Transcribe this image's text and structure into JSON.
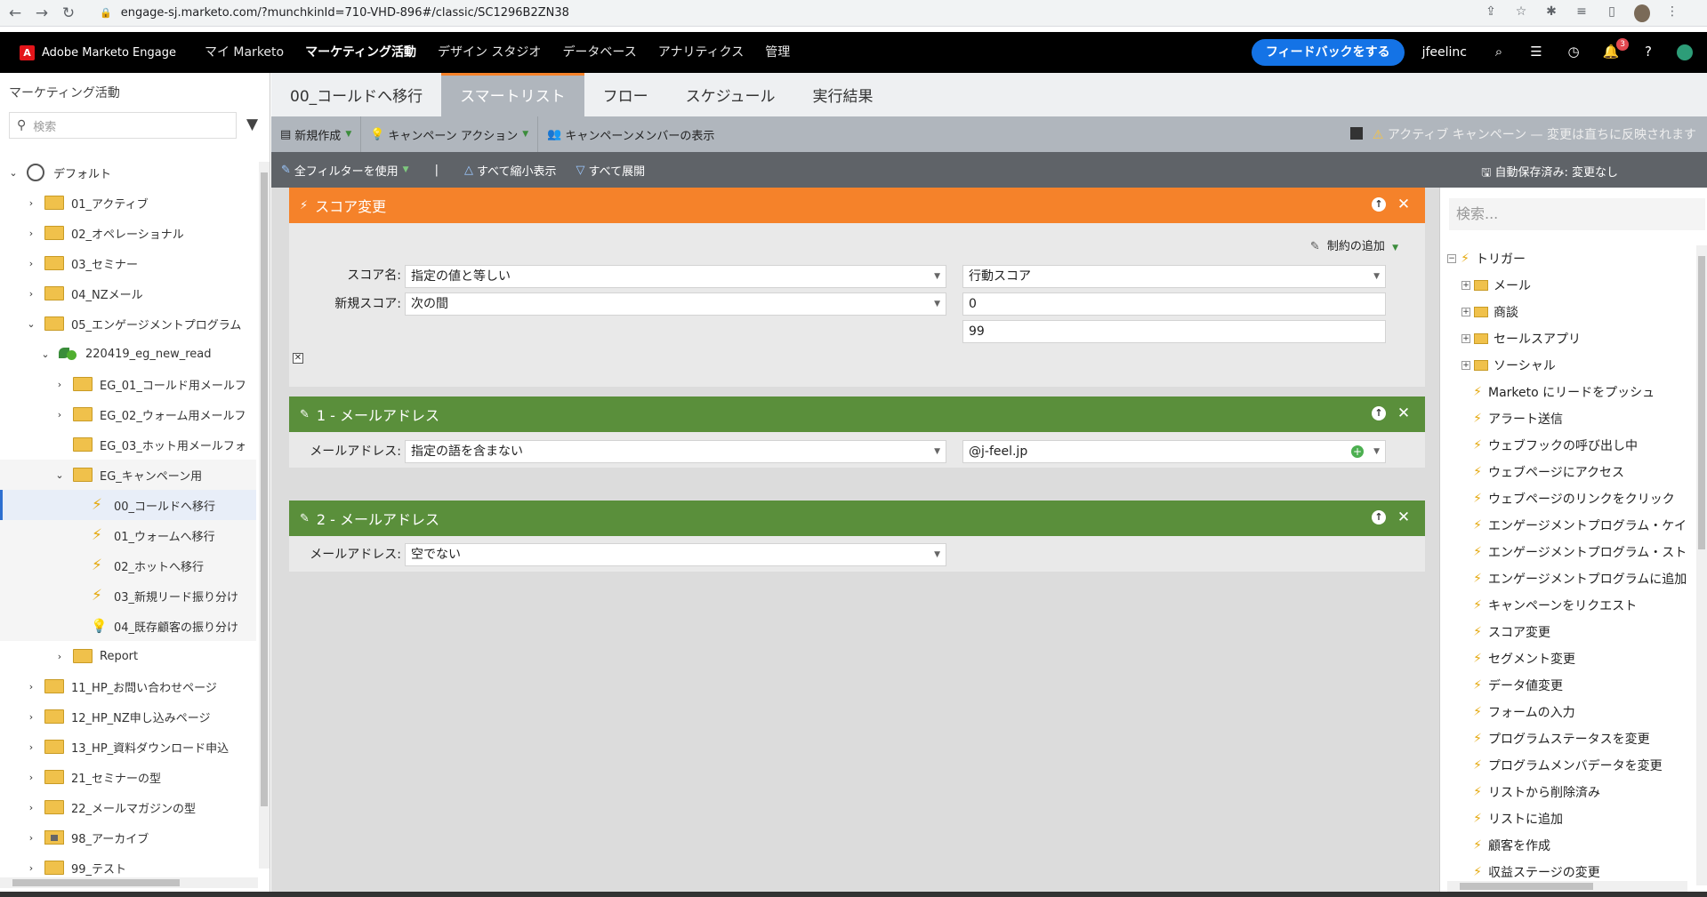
{
  "browser": {
    "url": "engage-sj.marketo.com/?munchkinId=710-VHD-896#/classic/SC1296B2ZN38"
  },
  "topnav": {
    "logo": "Adobe Marketo Engage",
    "menu": [
      "マイ Marketo",
      "マーケティング活動",
      "デザイン スタジオ",
      "データベース",
      "アナリティクス",
      "管理"
    ],
    "feedback": "フィードバックをする",
    "user": "jfeelinc",
    "notifications": "3"
  },
  "left": {
    "title": "マーケティング活動",
    "search_placeholder": "検索",
    "tree": [
      {
        "label": "デフォルト",
        "type": "globe",
        "chev": "⌄",
        "indent": 8
      },
      {
        "label": "01_アクティブ",
        "type": "folder",
        "chev": "›",
        "indent": 28
      },
      {
        "label": "02_オペレーショナル",
        "type": "folder",
        "chev": "›",
        "indent": 28
      },
      {
        "label": "03_セミナー",
        "type": "folder",
        "chev": "›",
        "indent": 28
      },
      {
        "label": "04_NZメール",
        "type": "folder",
        "chev": "›",
        "indent": 28
      },
      {
        "label": "05_エンゲージメントプログラム",
        "type": "folder",
        "chev": "⌄",
        "indent": 28
      },
      {
        "label": "220419_eg_new_read",
        "type": "program",
        "chev": "⌄",
        "indent": 44
      },
      {
        "label": "EG_01_コールド用メールフ",
        "type": "folder",
        "chev": "›",
        "indent": 60
      },
      {
        "label": "EG_02_ウォーム用メールフ",
        "type": "folder",
        "chev": "›",
        "indent": 60
      },
      {
        "label": "EG_03_ホット用メールフォ",
        "type": "folder",
        "chev": "",
        "indent": 60
      },
      {
        "label": "EG_キャンペーン用",
        "type": "folder",
        "chev": "⌄",
        "indent": 60
      },
      {
        "label": "00_コールドへ移行",
        "type": "bolt",
        "chev": "",
        "indent": 80
      },
      {
        "label": "01_ウォームへ移行",
        "type": "bolt",
        "chev": "",
        "indent": 80
      },
      {
        "label": "02_ホットへ移行",
        "type": "bolt",
        "chev": "",
        "indent": 80
      },
      {
        "label": "03_新規リード振り分け",
        "type": "bolt",
        "chev": "",
        "indent": 80
      },
      {
        "label": "04_既存顧客の振り分け",
        "type": "bulb",
        "chev": "",
        "indent": 80
      },
      {
        "label": "Report",
        "type": "folder",
        "chev": "›",
        "indent": 60
      },
      {
        "label": "11_HP_お問い合わせページ",
        "type": "folder",
        "chev": "›",
        "indent": 28
      },
      {
        "label": "12_HP_NZ申し込みページ",
        "type": "folder",
        "chev": "›",
        "indent": 28
      },
      {
        "label": "13_HP_資料ダウンロード申込",
        "type": "folder",
        "chev": "›",
        "indent": 28
      },
      {
        "label": "21_セミナーの型",
        "type": "folder",
        "chev": "›",
        "indent": 28
      },
      {
        "label": "22_メールマガジンの型",
        "type": "folder",
        "chev": "›",
        "indent": 28
      },
      {
        "label": "98_アーカイブ",
        "type": "archive",
        "chev": "›",
        "indent": 28
      },
      {
        "label": "99_テスト",
        "type": "folder",
        "chev": "›",
        "indent": 28
      }
    ]
  },
  "tabs": [
    "00_コールドへ移行",
    "スマートリスト",
    "フロー",
    "スケジュール",
    "実行結果"
  ],
  "toolbar1": {
    "new": "新規作成",
    "campaign_action": "キャンペーン アクション",
    "show_members": "キャンペーンメンバーの表示",
    "warning": "アクティブ キャンペーン — 変更は直ちに反映されます"
  },
  "toolbar2": {
    "use_all_filters": "全フィルターを使用",
    "separator": "|",
    "collapse_all": "すべて縮小表示",
    "expand_all": "すべて展開",
    "autosave": "自動保存済み: 変更なし"
  },
  "filters": {
    "score": {
      "title": "スコア変更",
      "add_constraint": "制約の追加",
      "score_name_label": "スコア名:",
      "score_name_operator": "指定の値と等しい",
      "score_name_value": "行動スコア",
      "new_score_label": "新規スコア:",
      "new_score_operator": "次の間",
      "new_score_min": "0",
      "new_score_max": "99"
    },
    "email1": {
      "title": "1 - メールアドレス",
      "label": "メールアドレス:",
      "operator": "指定の語を含まない",
      "value": "@j-feel.jp"
    },
    "email2": {
      "title": "2 - メールアドレス",
      "label": "メールアドレス:",
      "operator": "空でない"
    }
  },
  "right": {
    "search_placeholder": "検索...",
    "items": [
      {
        "label": "トリガー",
        "kind": "root"
      },
      {
        "label": "メール",
        "kind": "folder"
      },
      {
        "label": "商談",
        "kind": "folder"
      },
      {
        "label": "セールスアプリ",
        "kind": "folder"
      },
      {
        "label": "ソーシャル",
        "kind": "folder"
      },
      {
        "label": "Marketo にリードをプッシュ",
        "kind": "trigger"
      },
      {
        "label": "アラート送信",
        "kind": "trigger"
      },
      {
        "label": "ウェブフックの呼び出し中",
        "kind": "trigger"
      },
      {
        "label": "ウェブページにアクセス",
        "kind": "trigger"
      },
      {
        "label": "ウェブページのリンクをクリック",
        "kind": "trigger"
      },
      {
        "label": "エンゲージメントプログラム・ケイ",
        "kind": "trigger"
      },
      {
        "label": "エンゲージメントプログラム・スト",
        "kind": "trigger"
      },
      {
        "label": "エンゲージメントプログラムに追加",
        "kind": "trigger"
      },
      {
        "label": "キャンペーンをリクエスト",
        "kind": "trigger"
      },
      {
        "label": "スコア変更",
        "kind": "trigger"
      },
      {
        "label": "セグメント変更",
        "kind": "trigger"
      },
      {
        "label": "データ値変更",
        "kind": "trigger"
      },
      {
        "label": "フォームの入力",
        "kind": "trigger"
      },
      {
        "label": "プログラムステータスを変更",
        "kind": "trigger"
      },
      {
        "label": "プログラムメンバデータを変更",
        "kind": "trigger"
      },
      {
        "label": "リストから削除済み",
        "kind": "trigger"
      },
      {
        "label": "リストに追加",
        "kind": "trigger"
      },
      {
        "label": "顧客を作成",
        "kind": "trigger"
      },
      {
        "label": "収益ステージの変更",
        "kind": "trigger"
      }
    ]
  }
}
